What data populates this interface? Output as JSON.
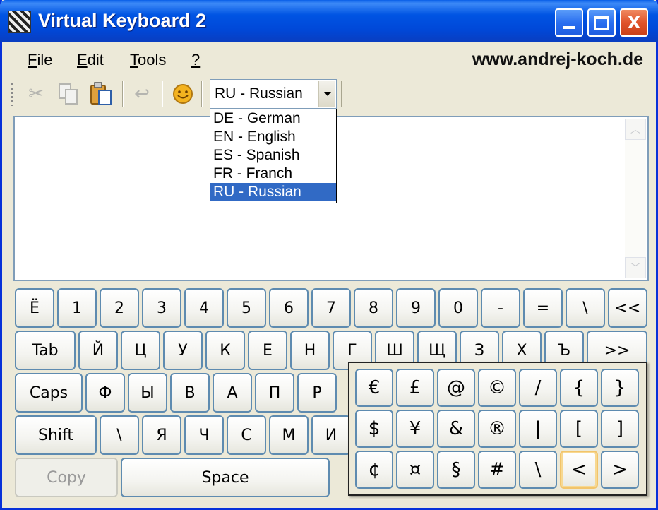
{
  "window": {
    "title": "Virtual Keyboard 2",
    "minimize_label": "",
    "maximize_label": "",
    "close_label": "X"
  },
  "menu": {
    "items": [
      {
        "first": "F",
        "rest": "ile"
      },
      {
        "first": "E",
        "rest": "dit"
      },
      {
        "first": "T",
        "rest": "ools"
      },
      {
        "first": "?",
        "rest": ""
      }
    ],
    "website": "www.andrej-koch.de"
  },
  "toolbar": {
    "icons": [
      "cut-icon",
      "copy-icon",
      "paste-icon",
      "undo-icon",
      "smiley-icon"
    ],
    "language": {
      "selected": "RU - Russian",
      "options": [
        "DE - German",
        "EN - English",
        "ES - Spanish",
        "FR - Franch",
        "RU - Russian"
      ]
    }
  },
  "textarea": {
    "value": ""
  },
  "keyboard": {
    "rows": [
      [
        "Ё",
        "1",
        "2",
        "3",
        "4",
        "5",
        "6",
        "7",
        "8",
        "9",
        "0",
        "-",
        "=",
        "\\",
        "<<"
      ],
      [
        "Tab",
        "Й",
        "Ц",
        "У",
        "К",
        "Е",
        "Н",
        "Г",
        "Ш",
        "Щ",
        "З",
        "Х",
        "Ъ",
        ">>"
      ],
      [
        "Caps",
        "Ф",
        "Ы",
        "В",
        "А",
        "П",
        "Р"
      ],
      [
        "Shift",
        "\\",
        "Я",
        "Ч",
        "С",
        "М",
        "И"
      ],
      [
        "Copy",
        "Space"
      ]
    ]
  },
  "symbols": {
    "rows": [
      [
        "€",
        "£",
        "@",
        "©",
        "/",
        "{",
        "}"
      ],
      [
        "$",
        "¥",
        "&",
        "®",
        "|",
        "[",
        "]"
      ],
      [
        "¢",
        "¤",
        "§",
        "#",
        "\\",
        "<",
        ">"
      ]
    ],
    "focused": "<"
  },
  "colors": {
    "titlebar": "#0054e3",
    "window_bg": "#ece9d8",
    "selection": "#316ac5",
    "key_border": "#5e8bb0"
  }
}
